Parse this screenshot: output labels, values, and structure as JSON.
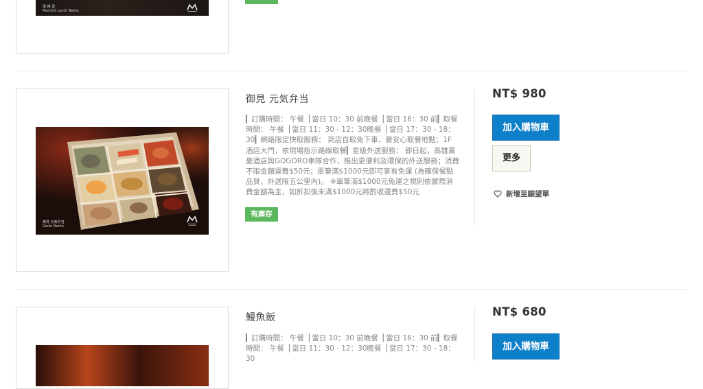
{
  "currency_prefix": "NT$",
  "products": [
    {
      "caption_line1": "蛋 捲 堡",
      "caption_line2": "Marriott Lunch Bento"
    },
    {
      "name": "御見 元気弁当",
      "description": "▎訂購時間： 午餐▕ 當日 10：30 前晚餐▕ 當日 16：30 前▎取餐時間： 午餐▕ 當日 11：30 - 12：30晚餐▕ 當日 17：30 - 18：30▎網路限定快取服務： 到店自取免下車，豪安心取餐地點：1F 酒店大門，依現場指示路線取餐▎星級外送服務： 即日起，高雄萬豪酒店與GOGORO車隊合作，推出更便利及環保的外送服務；消費不限金額運費$50元；單筆滿$1000元即可享有免運 (為確保餐點品質，外送限五公里內)。 ※單筆滿$1000元免運之規則依實際消費金額為主，如折扣後未滿$1000元將酌收運費$50元",
      "stock_label": "有庫存",
      "price": "NT$ 980",
      "add_to_cart": "加入購物車",
      "more": "更多",
      "wishlist": "新增至願望單",
      "caption_line1": "御見 元気弁当",
      "caption_line2": "Genki Bento"
    },
    {
      "name": "鰻魚飯",
      "description": "▎訂購時間： 午餐▕ 當日 10：30 前晚餐▕ 當日 16：30 前▎取餐時間： 午餐▕ 當日 11：30 - 12：30晚餐▕ 當日 17：30 - 18：30",
      "price": "NT$ 680",
      "add_to_cart": "加入購物車"
    }
  ],
  "colors": {
    "cart_button": "#0e7fc9",
    "stock_badge": "#5cb85c",
    "divider": "#e3e3e3"
  },
  "icons": {
    "wishlist": "heart-outline-icon",
    "brand": "marriott-logo-icon"
  }
}
